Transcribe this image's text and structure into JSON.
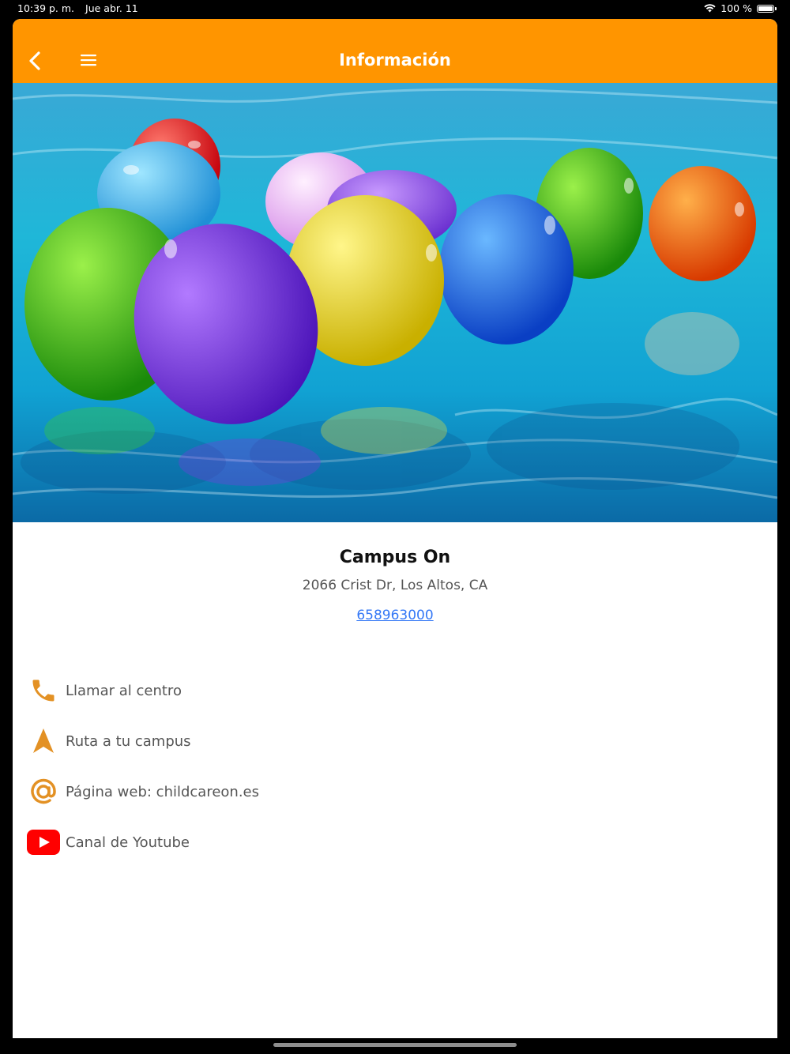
{
  "status": {
    "time": "10:39 p. m.",
    "date": "Jue abr. 11",
    "battery": "100 %"
  },
  "nav": {
    "title": "Información",
    "back_icon": "chevron-left-icon",
    "menu_icon": "hamburger-menu-icon",
    "color": "#ff9500"
  },
  "hero": {
    "image": "colorful-balloons-floating-in-pool"
  },
  "campus": {
    "name": "Campus On",
    "address": "2066 Crist Dr, Los Altos, CA",
    "phone": "658963000"
  },
  "actions": [
    {
      "icon": "phone-icon",
      "label": "Llamar al centro"
    },
    {
      "icon": "navigation-arrow-icon",
      "label": "Ruta a tu campus"
    },
    {
      "icon": "at-sign-icon",
      "label": "Página web: childcareon.es"
    },
    {
      "icon": "youtube-icon",
      "label": "Canal de Youtube"
    }
  ],
  "colors": {
    "accent": "#ff9500",
    "icon": "#e39124",
    "link": "#3478f6",
    "youtube": "#ff0000"
  }
}
